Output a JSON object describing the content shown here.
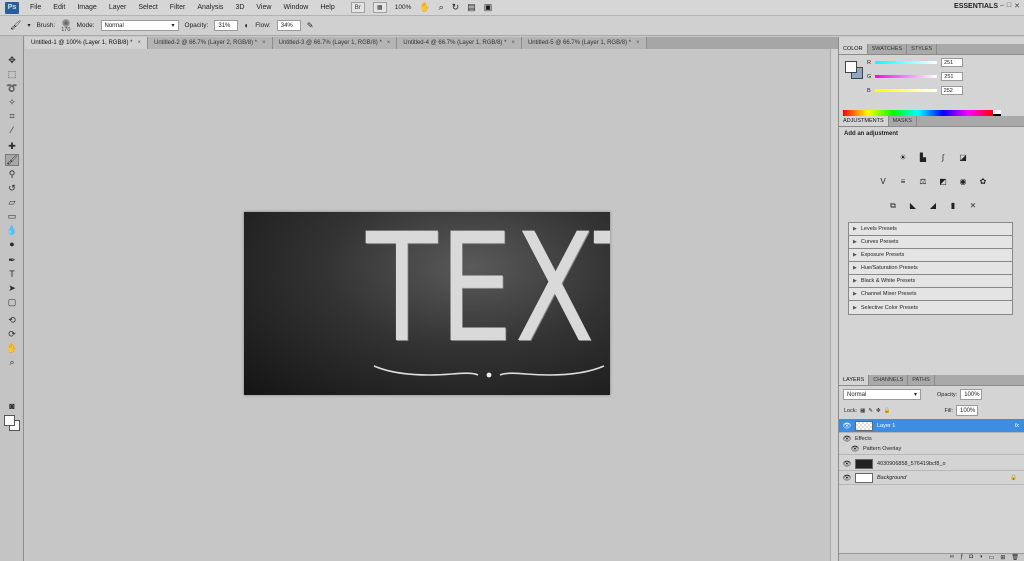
{
  "app": {
    "logo": "Ps"
  },
  "menubar": {
    "items": [
      "File",
      "Edit",
      "Image",
      "Layer",
      "Select",
      "Filter",
      "Analysis",
      "3D",
      "View",
      "Window",
      "Help"
    ],
    "bridge_label": "Br",
    "zoom_value": "100%",
    "workspace": "ESSENTIALS"
  },
  "options": {
    "brush_label": "Brush:",
    "brush_size": "170",
    "mode_label": "Mode:",
    "mode_value": "Normal",
    "opacity_label": "Opacity:",
    "opacity_value": "31%",
    "flow_label": "Flow:",
    "flow_value": "34%"
  },
  "doc_tabs": [
    {
      "label": "Untitled-1 @ 100% (Layer 1, RGB/8) *"
    },
    {
      "label": "Untitled-2 @ 66.7% (Layer 2, RGB/8) *"
    },
    {
      "label": "Untitled-3 @ 66.7% (Layer 1, RGB/8) *"
    },
    {
      "label": "Untitled-4 @ 66.7% (Layer 1, RGB/8) *"
    },
    {
      "label": "Untitled-5 @ 66.7% (Layer 1, RGB/8) *"
    }
  ],
  "artwork": {
    "text": "TEXT"
  },
  "color_panel": {
    "tabs": [
      "COLOR",
      "SWATCHES",
      "STYLES"
    ],
    "r_label": "R",
    "r_value": "251",
    "g_label": "G",
    "g_value": "251",
    "b_label": "B",
    "b_value": "252"
  },
  "adjustments": {
    "tabs": [
      "ADJUSTMENTS",
      "MASKS"
    ],
    "title": "Add an adjustment",
    "presets": [
      "Levels Presets",
      "Curves Presets",
      "Exposure Presets",
      "Hue/Saturation Presets",
      "Black & White Presets",
      "Channel Mixer Presets",
      "Selective Color Presets"
    ]
  },
  "layers": {
    "tabs": [
      "LAYERS",
      "CHANNELS",
      "PATHS"
    ],
    "blend_mode": "Normal",
    "opacity_label": "Opacity:",
    "opacity_value": "100%",
    "lock_label": "Lock:",
    "fill_label": "Fill:",
    "fill_value": "100%",
    "items": [
      {
        "name": "Layer 1",
        "fx": "fx"
      },
      {
        "name": "Effects"
      },
      {
        "name": "Pattern Overlay"
      },
      {
        "name": "4030906858_576419bcf8_o"
      },
      {
        "name": "Background"
      }
    ]
  }
}
